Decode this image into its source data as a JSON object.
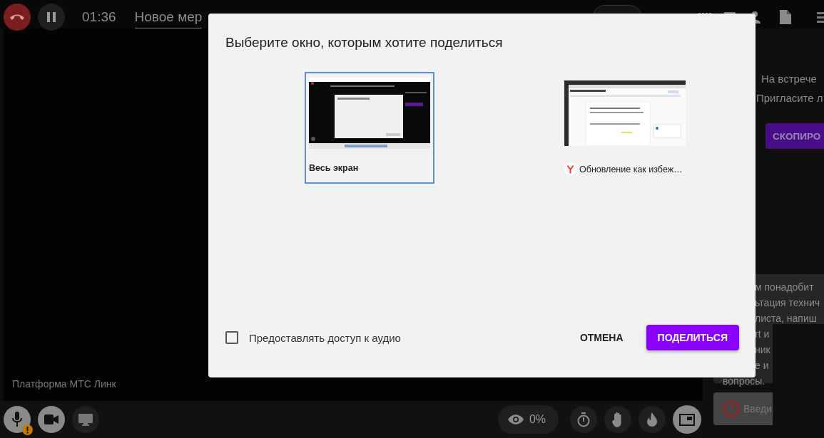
{
  "top_bar": {
    "timer": "01:36",
    "meeting_title": "Новое мер"
  },
  "side_panel": {
    "lines": [
      "На встрече",
      "Пригласите л"
    ],
    "copy_button": "СКОПИРО",
    "chat_message": {
      "lines": [
        "м понадобит",
        "ьтация технич",
        "листа, напиш",
        "rt и",
        "ник",
        "е и",
        "вопросы."
      ]
    },
    "message_field": {
      "placeholder": "Введи"
    }
  },
  "stage": {
    "caption": "Платформа МТС Линк"
  },
  "bottom_bar": {
    "mic_warning": true,
    "viewers": "0%"
  },
  "dialog": {
    "title": "Выберите окно, которым хотите поделиться",
    "sources": [
      {
        "label": "Весь экран",
        "selected": true,
        "kind": "screen"
      },
      {
        "label": "Обновление как избеж…",
        "selected": false,
        "kind": "window"
      }
    ],
    "audio_checkbox": {
      "label": "Предоставлять доступ к аудио",
      "checked": false
    },
    "buttons": [
      {
        "label": "ОТМЕНА",
        "kind": "text"
      },
      {
        "label": "ПОДЕЛИТЬСЯ",
        "kind": "primary"
      }
    ]
  }
}
